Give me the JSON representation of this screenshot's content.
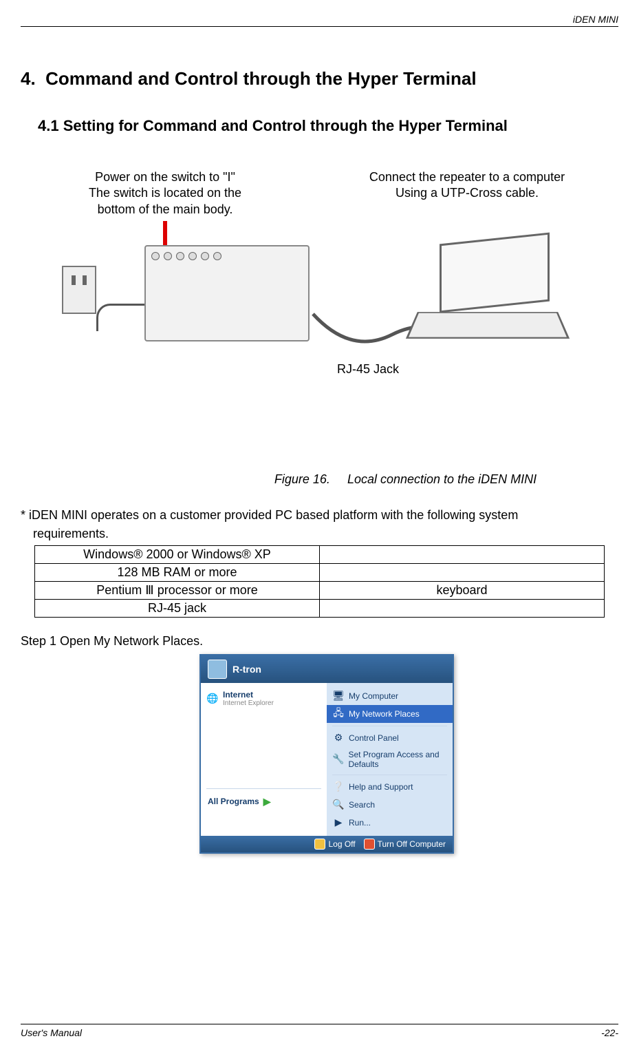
{
  "header": {
    "title": "iDEN MINI"
  },
  "section": {
    "number": "4.",
    "title": "Command and Control through the Hyper Terminal"
  },
  "subsection": {
    "number": "4.1",
    "title": "Setting for Command and Control through the Hyper Terminal"
  },
  "figure": {
    "caption_left_l1": "Power on the switch to \"I\"",
    "caption_left_l2": "The switch is located on the",
    "caption_left_l3": "bottom of the main body.",
    "caption_right_l1": "Connect the repeater to a computer",
    "caption_right_l2": "Using a UTP-Cross  cable.",
    "jack_label": "RJ-45 Jack",
    "caption_label": "Figure 16.",
    "caption_text": "Local connection to the iDEN MINI"
  },
  "note": {
    "line1": "* iDEN MINI operates on a customer provided PC based platform with the following system",
    "line2": "requirements."
  },
  "requirements": {
    "rows": [
      {
        "left": "Windows® 2000 or Windows® XP",
        "right": ""
      },
      {
        "left": "128 MB RAM or more",
        "right": ""
      },
      {
        "left": "Pentium Ⅲ processor or more",
        "right": "keyboard"
      },
      {
        "left": "RJ-45 jack",
        "right": ""
      }
    ]
  },
  "step": {
    "text": "Step 1 Open My Network Places."
  },
  "startmenu": {
    "user": "R-tron",
    "left": {
      "item1": {
        "title": "Internet",
        "sub": "Internet Explorer"
      },
      "bottom": "All Programs"
    },
    "right": {
      "items": [
        "My Computer",
        "My Network Places",
        "Control Panel",
        "Set Program Access and Defaults",
        "Help and Support",
        "Search",
        "Run..."
      ],
      "highlight_index": 1
    },
    "footer": {
      "logoff": "Log Off",
      "turnoff": "Turn Off Computer"
    }
  },
  "footer": {
    "left": "User's Manual",
    "right": "-22-"
  }
}
